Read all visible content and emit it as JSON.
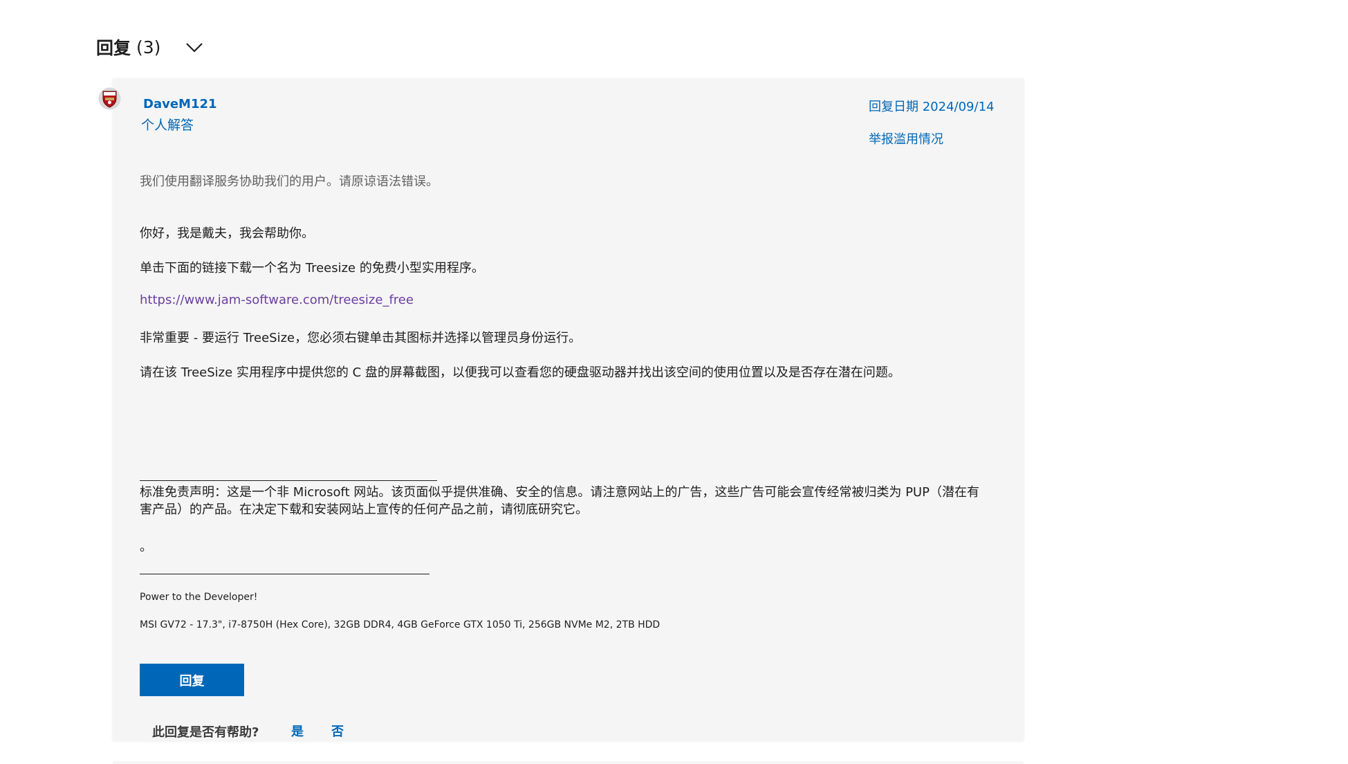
{
  "replies": {
    "title": "回复",
    "count": "(3)"
  },
  "post": {
    "author": "DaveM121",
    "role": "个人解答",
    "reply_date": "回复日期 2024/09/14",
    "report_abuse": "举报滥用情况",
    "translation_note": "我们使用翻译服务协助我们的用户。请原谅语法错误。",
    "paragraphs": [
      "你好，我是戴夫，我会帮助你。",
      "单击下面的链接下载一个名为 Treesize 的免费小型实用程序。",
      "非常重要 - 要运行 TreeSize，您必须右键单击其图标并选择以管理员身份运行。",
      "请在该 TreeSize 实用程序中提供您的 C 盘的屏幕截图，以便我可以查看您的硬盘驱动器并找出该空间的使用位置以及是否存在潜在问题。"
    ],
    "link": "https://www.jam-software.com/treesize_free",
    "disclaimer": "标准免责声明：这是一个非 Microsoft 网站。该页面似乎提供准确、安全的信息。请注意网站上的广告，这些广告可能会宣传经常被归类为 PUP（潜在有害产品）的产品。在决定下载和安装网站上宣传的任何产品之前，请彻底研究它。",
    "period": "。",
    "signature_line1": "Power to the Developer!",
    "signature_line2": "MSI GV72 - 17.3\", i7-8750H (Hex Core), 32GB DDR4, 4GB GeForce GTX 1050 Ti, 256GB NVMe M2, 2TB HDD"
  },
  "actions": {
    "reply_button": "回复",
    "helpful_question": "此回复是否有帮助?",
    "yes": "是",
    "no": "否"
  },
  "icons": {
    "chevron": "chevron-down-icon",
    "avatar": "arsenal-crest-avatar"
  },
  "colors": {
    "accent": "#0067b8",
    "link_visited": "#6b3fa0",
    "card_bg": "#f5f5f5"
  }
}
